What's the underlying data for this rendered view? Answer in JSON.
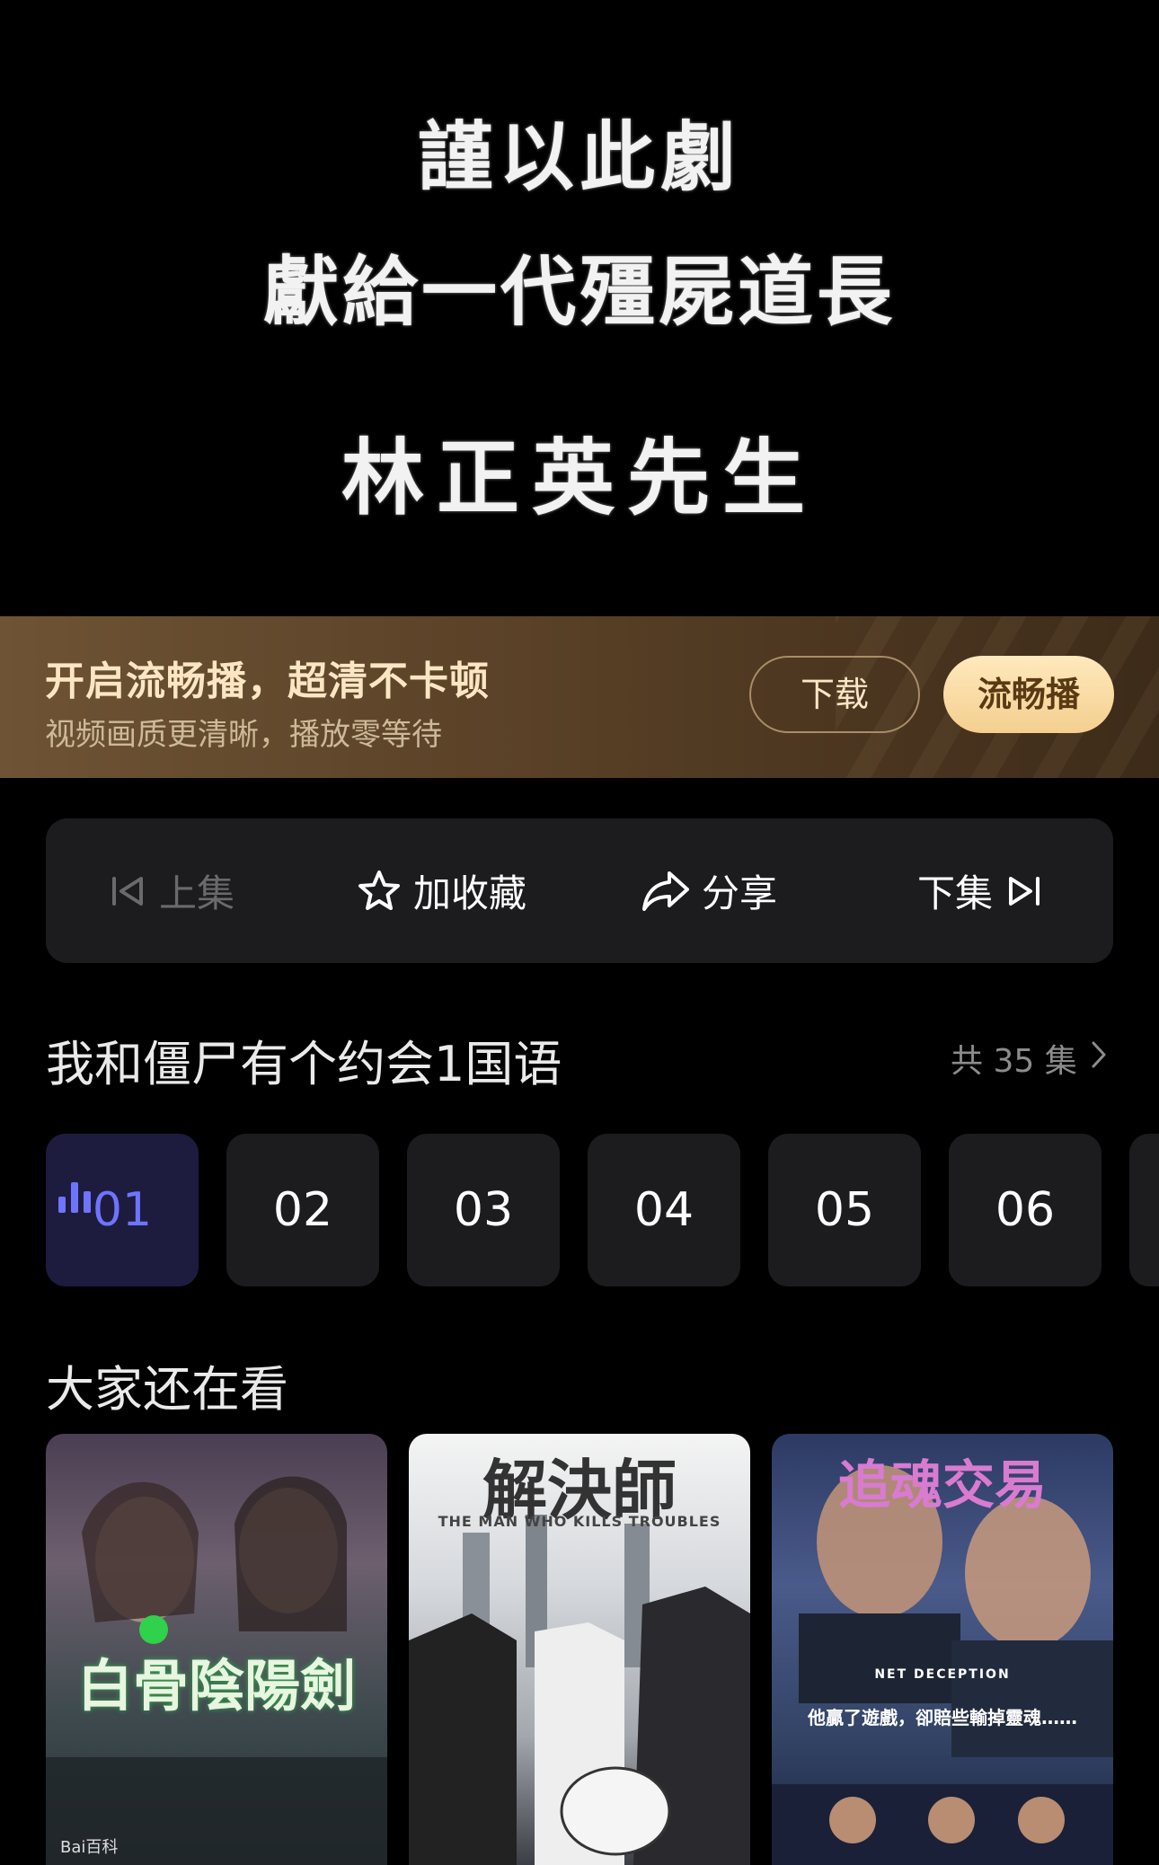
{
  "video": {
    "caption_line1": "謹以此劇",
    "caption_line2": "獻給一代殭屍道長",
    "caption_line3": "林正英先生"
  },
  "banner": {
    "title": "开启流畅播，超清不卡顿",
    "subtitle": "视频画质更清晰，播放零等待",
    "download_label": "下载",
    "smooth_label": "流畅播"
  },
  "actions": {
    "prev_label": "上集",
    "favorite_label": "加收藏",
    "share_label": "分享",
    "next_label": "下集"
  },
  "episodes": {
    "title": "我和僵尸有个约会1国语",
    "count_label": "共 35 集",
    "items": [
      "01",
      "02",
      "03",
      "04",
      "05",
      "06"
    ],
    "active_index": 0
  },
  "recommend": {
    "title": "大家还在看",
    "posters": [
      {
        "title_art": "白骨陰陽劍",
        "watermark": "Bai百科"
      },
      {
        "title_art": "解決師",
        "subtitle_art": "THE MAN WHO KILLS TROUBLES"
      },
      {
        "title_art": "追魂交易",
        "subtitle_art": "NET DECEPTION",
        "tagline": "他贏了遊戲，卻賠些輸掉靈魂……"
      }
    ]
  },
  "colors": {
    "accent": "#6f74ff",
    "banner_gold": "#fbe6c4",
    "card_bg": "#1c1c1e"
  }
}
